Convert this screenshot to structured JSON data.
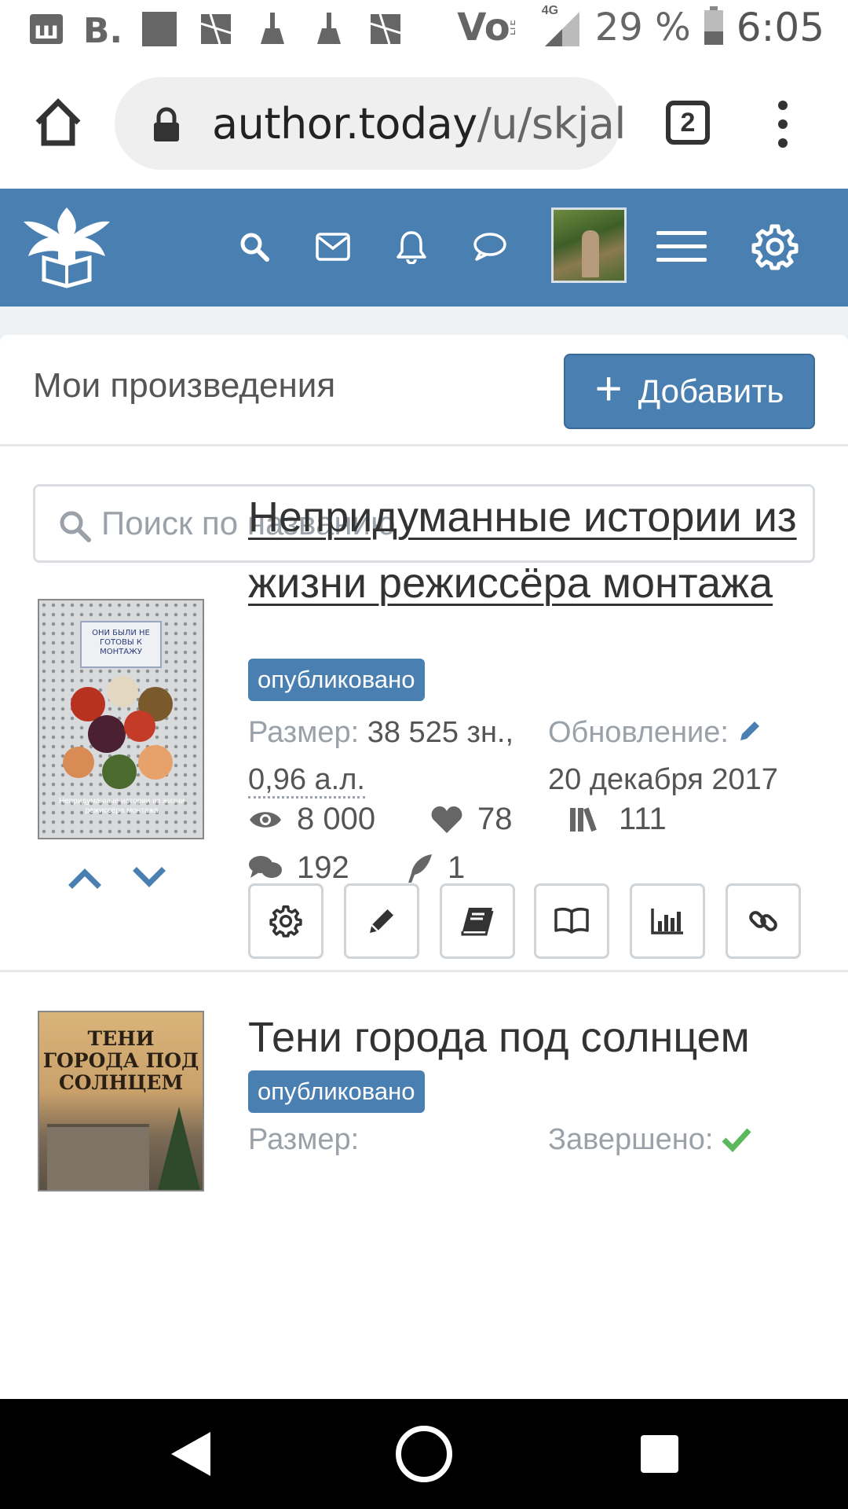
{
  "status_bar": {
    "battery": "29 %",
    "time": "6:05",
    "network": "4G",
    "left_icons": [
      "w-icon",
      "b-icon",
      "square-icon",
      "map-icon",
      "broom-icon",
      "broom-icon",
      "map-icon"
    ],
    "volte_label": "Vo",
    "lte_label": "LTE"
  },
  "browser": {
    "url_host": "author.today",
    "url_path": "/u/skjal",
    "tab_count": "2"
  },
  "site_header": {
    "brand_color": "#4a7fb1"
  },
  "page": {
    "title": "Мои произведения",
    "add_button_label": "Добавить",
    "search_placeholder": "Поиск по названию"
  },
  "works": [
    {
      "title": "Непридуманные истории из жизни режиссёра монтажа",
      "status": "опубликовано",
      "size_label": "Размер:",
      "size_value": "38 525 зн.,",
      "size_value2": "0,96 а.л.",
      "update_label": "Обновление:",
      "update_date": "20 декабря 2017",
      "views": "8 000",
      "likes": "78",
      "libraries": "111",
      "comments": "192",
      "rewards": "1",
      "cover_label": "ОНИ БЫЛИ НЕ ГОТОВЫ К МОНТАЖУ",
      "cover_footer": "Непридуманные истории из жизни режиссёра монтажа"
    },
    {
      "title": "Тени города под солнцем",
      "status": "опубликовано",
      "size_label": "Размер:",
      "finished_label": "Завершено:",
      "cover_title": "ТЕНИ ГОРОДА ПОД СОЛНЦЕМ"
    }
  ]
}
